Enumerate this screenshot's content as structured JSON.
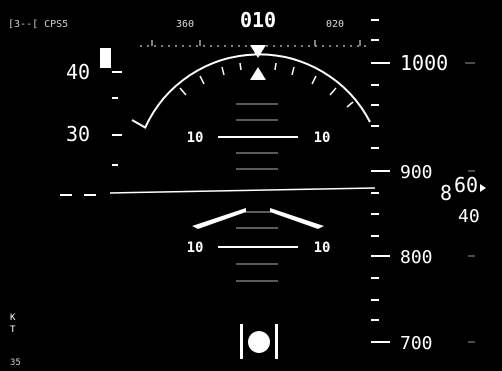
{
  "status": {
    "top_left": "[3--[ CPS5",
    "bottom_left": "35",
    "side_k": "K",
    "side_t": "T"
  },
  "heading": {
    "left": "360",
    "current": "010",
    "right": "020"
  },
  "airspeed": {
    "labels": [
      "40",
      "30"
    ]
  },
  "pitch": {
    "labels": [
      "10",
      "10",
      "10",
      "10"
    ]
  },
  "altitude": {
    "labels": [
      "1000",
      "900",
      "800",
      "700"
    ],
    "readout_main": "8",
    "readout_hi": "60",
    "readout_lo": "40"
  },
  "colors": {
    "foreground": "#ffffff",
    "background": "#000000"
  }
}
